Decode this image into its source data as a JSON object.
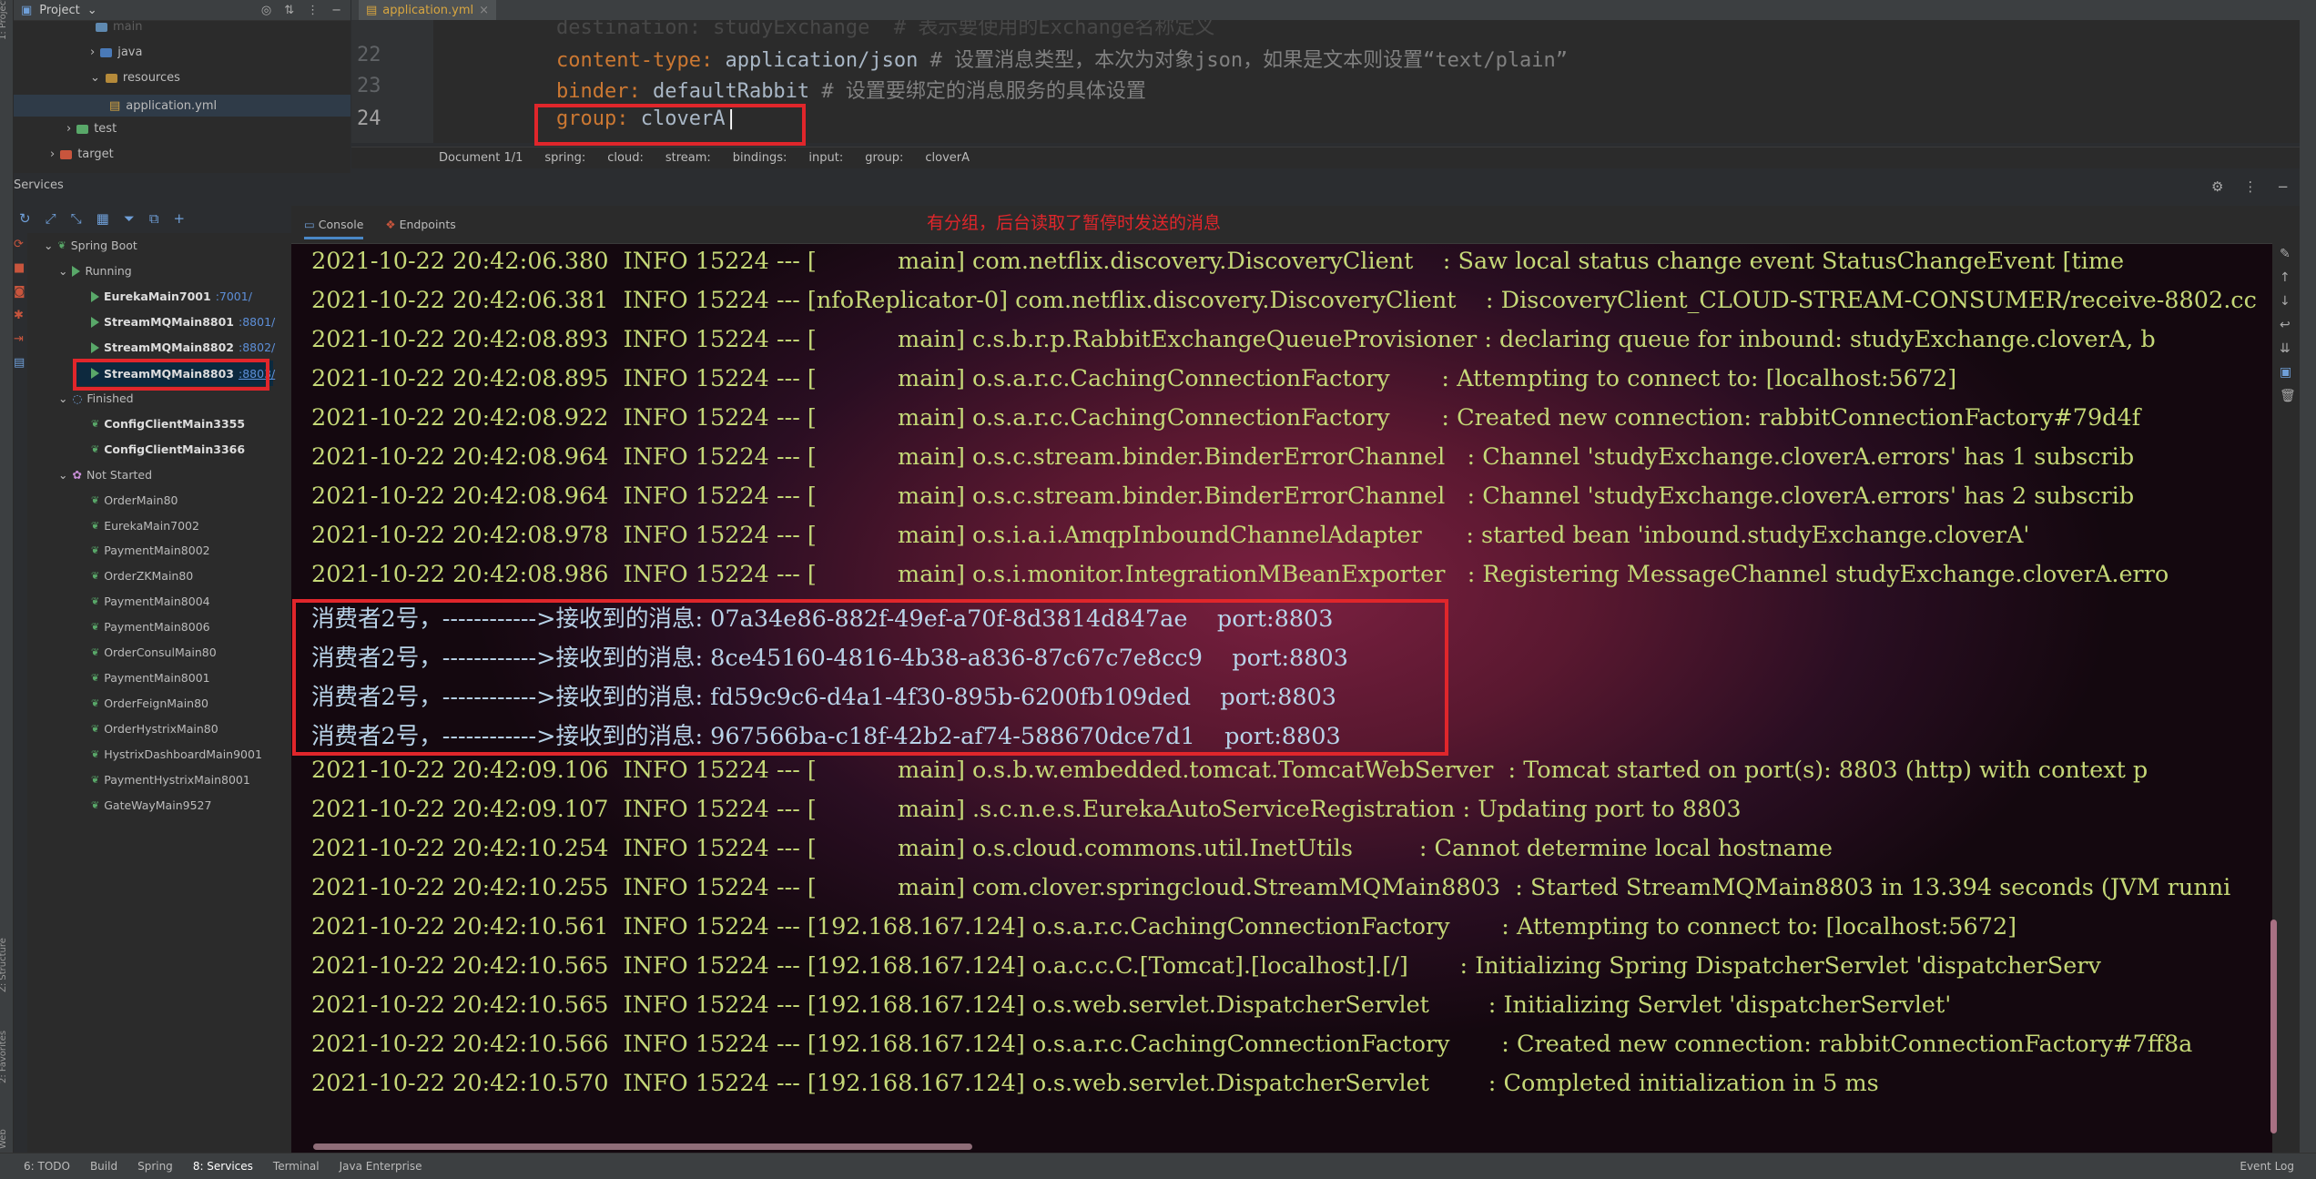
{
  "left_strip": {
    "project_label": "1: Project",
    "structure_label": "Z: Structure",
    "favorites_label": "2: Favorites",
    "web_label": "Web"
  },
  "project_panel": {
    "title": "Project",
    "tree": [
      {
        "label": "main",
        "indent": 1
      },
      {
        "label": "java",
        "indent": 2
      },
      {
        "label": "resources",
        "indent": 2
      },
      {
        "label": "application.yml",
        "indent": 3
      },
      {
        "label": "test",
        "indent": 1
      },
      {
        "label": "target",
        "indent": 0
      }
    ]
  },
  "editor": {
    "tab": "application.yml",
    "lines": [
      {
        "num": "22",
        "key": "content-type",
        "value": "application/json",
        "comment": "# 设置消息类型，本次为对象json，如果是文本则设置“text/plain”"
      },
      {
        "num": "23",
        "key": "binder",
        "value": "defaultRabbit",
        "comment": "# 设置要绑定的消息服务的具体设置"
      },
      {
        "num": "24",
        "key": "group",
        "value": "cloverA",
        "comment": ""
      }
    ],
    "partial_top_line": "destination: studyExchange  # 表示要使用的Exchange名称定义",
    "breadcrumb": [
      "Document 1/1",
      "spring:",
      "cloud:",
      "stream:",
      "bindings:",
      "input:",
      "group:",
      "cloverA"
    ]
  },
  "services": {
    "title": "Services",
    "root": "Spring Boot",
    "running_label": "Running",
    "running": [
      {
        "name": "EurekaMain7001",
        "port": ":7001/"
      },
      {
        "name": "StreamMQMain8801",
        "port": ":8801/"
      },
      {
        "name": "StreamMQMain8802",
        "port": ":8802/"
      },
      {
        "name": "StreamMQMain8803",
        "port": ":8803/"
      }
    ],
    "finished_label": "Finished",
    "finished": [
      "ConfigClientMain3355",
      "ConfigClientMain3366"
    ],
    "not_started_label": "Not Started",
    "not_started": [
      "OrderMain80",
      "EurekaMain7002",
      "PaymentMain8002",
      "OrderZKMain80",
      "PaymentMain8004",
      "PaymentMain8006",
      "OrderConsulMain80",
      "PaymentMain8001",
      "OrderFeignMain80",
      "OrderHystrixMain80",
      "HystrixDashboardMain9001",
      "PaymentHystrixMain8001",
      "GateWayMain9527"
    ]
  },
  "console": {
    "tabs": [
      "Console",
      "Endpoints"
    ],
    "annotation": "有分组，后台读取了暂停时发送的消息",
    "lines": [
      "2021-10-22 20:42:06.380  INFO 15224 --- [           main] com.netflix.discovery.DiscoveryClient    : Saw local status change event StatusChangeEvent [time",
      "2021-10-22 20:42:06.381  INFO 15224 --- [nfoReplicator-0] com.netflix.discovery.DiscoveryClient    : DiscoveryClient_CLOUD-STREAM-CONSUMER/receive-8802.cc",
      "2021-10-22 20:42:08.893  INFO 15224 --- [           main] c.s.b.r.p.RabbitExchangeQueueProvisioner : declaring queue for inbound: studyExchange.cloverA, b",
      "2021-10-22 20:42:08.895  INFO 15224 --- [           main] o.s.a.r.c.CachingConnectionFactory       : Attempting to connect to: [localhost:5672]",
      "2021-10-22 20:42:08.922  INFO 15224 --- [           main] o.s.a.r.c.CachingConnectionFactory       : Created new connection: rabbitConnectionFactory#79d4f",
      "2021-10-22 20:42:08.964  INFO 15224 --- [           main] o.s.c.stream.binder.BinderErrorChannel   : Channel 'studyExchange.cloverA.errors' has 1 subscrib",
      "2021-10-22 20:42:08.964  INFO 15224 --- [           main] o.s.c.stream.binder.BinderErrorChannel   : Channel 'studyExchange.cloverA.errors' has 2 subscrib",
      "2021-10-22 20:42:08.978  INFO 15224 --- [           main] o.s.i.a.i.AmqpInboundChannelAdapter      : started bean 'inbound.studyExchange.cloverA'",
      "2021-10-22 20:42:08.986  INFO 15224 --- [           main] o.s.i.monitor.IntegrationMBeanExporter   : Registering MessageChannel studyExchange.cloverA.erro",
      "消费者2号，------------>接收到的消息: 07a34e86-882f-49ef-a70f-8d3814d847ae    port:8803",
      "消费者2号，------------>接收到的消息: 8ce45160-4816-4b38-a836-87c67c7e8cc9    port:8803",
      "消费者2号，------------>接收到的消息: fd59c9c6-d4a1-4f30-895b-6200fb109ded    port:8803",
      "消费者2号，------------>接收到的消息: 967566ba-c18f-42b2-af74-588670dce7d1    port:8803",
      "2021-10-22 20:42:09.106  INFO 15224 --- [           main] o.s.b.w.embedded.tomcat.TomcatWebServer  : Tomcat started on port(s): 8803 (http) with context p",
      "2021-10-22 20:42:09.107  INFO 15224 --- [           main] .s.c.n.e.s.EurekaAutoServiceRegistration : Updating port to 8803",
      "2021-10-22 20:42:10.254  INFO 15224 --- [           main] o.s.cloud.commons.util.InetUtils         : Cannot determine local hostname",
      "2021-10-22 20:42:10.255  INFO 15224 --- [           main] com.clover.springcloud.StreamMQMain8803  : Started StreamMQMain8803 in 13.394 seconds (JVM runni",
      "2021-10-22 20:42:10.561  INFO 15224 --- [192.168.167.124] o.s.a.r.c.CachingConnectionFactory       : Attempting to connect to: [localhost:5672]",
      "2021-10-22 20:42:10.565  INFO 15224 --- [192.168.167.124] o.a.c.c.C.[Tomcat].[localhost].[/]       : Initializing Spring DispatcherServlet 'dispatcherServ",
      "2021-10-22 20:42:10.565  INFO 15224 --- [192.168.167.124] o.s.web.servlet.DispatcherServlet        : Initializing Servlet 'dispatcherServlet'",
      "2021-10-22 20:42:10.566  INFO 15224 --- [192.168.167.124] o.s.a.r.c.CachingConnectionFactory       : Created new connection: rabbitConnectionFactory#7ff8a",
      "2021-10-22 20:42:10.570  INFO 15224 --- [192.168.167.124] o.s.web.servlet.DispatcherServlet        : Completed initialization in 5 ms"
    ]
  },
  "bottom_bar": [
    "6: TODO",
    "Build",
    "Spring",
    "8: Services",
    "Terminal",
    "Java Enterprise",
    "Event Log"
  ],
  "colors": {
    "highlight_red": "#e0262b",
    "log_text": "#c5d877",
    "accent_blue": "#4a88c7"
  }
}
